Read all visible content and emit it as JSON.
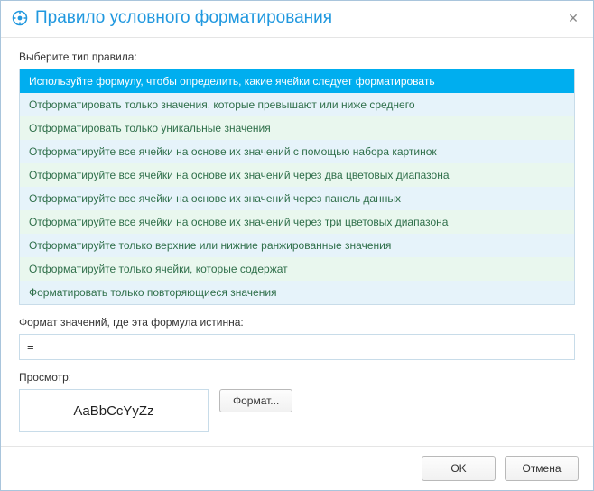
{
  "window": {
    "title": "Правило условного форматирования"
  },
  "labels": {
    "select_rule_type": "Выберите тип правила:",
    "formula_true": "Формат значений, где эта формула истинна:",
    "preview": "Просмотр:"
  },
  "rules": [
    "Используйте формулу, чтобы определить, какие ячейки следует форматировать",
    "Отформатировать только значения, которые превышают или ниже среднего",
    "Отформатировать только уникальные значения",
    "Отформатируйте все ячейки на основе их значений с помощью набора картинок",
    "Отформатируйте все ячейки на основе их значений через два цветовых диапазона",
    "Отформатируйте все ячейки на основе их значений через панель данных",
    "Отформатируйте все ячейки на основе их значений через три цветовых диапазона",
    "Отформатируйте только верхние или нижние ранжированные значения",
    "Отформатируйте только ячейки, которые содержат",
    "Форматировать только повторяющиеся значения"
  ],
  "selected_rule_index": 0,
  "formula": {
    "value": "="
  },
  "preview": {
    "sample": "AaBbCcYyZz"
  },
  "buttons": {
    "format": "Формат...",
    "ok": "OK",
    "cancel": "Отмена"
  }
}
